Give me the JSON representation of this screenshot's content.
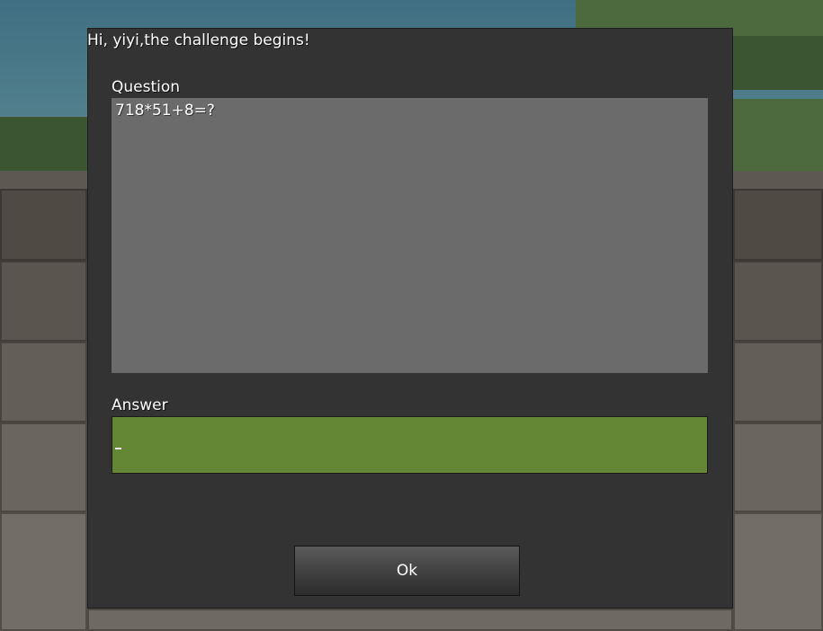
{
  "dialog": {
    "title": "Hi, yiyi,the challenge begins!",
    "question_label": "Question",
    "question_text": "718*51+8=?",
    "answer_label": "Answer",
    "answer_value": "",
    "ok_label": "Ok"
  },
  "colors": {
    "dialog_bg": "#333333",
    "question_bg": "#6b6b6b",
    "answer_bg": "#638734"
  }
}
